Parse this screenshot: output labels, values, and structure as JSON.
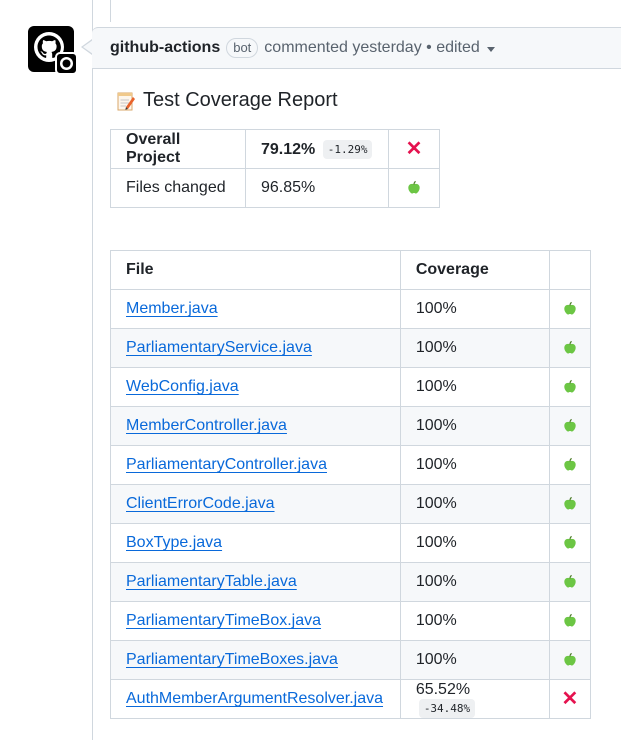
{
  "comment": {
    "author": "github-actions",
    "badge": "bot",
    "meta": "commented yesterday • edited"
  },
  "report": {
    "title": "Test Coverage Report",
    "title_icon": "memo-icon"
  },
  "summary": [
    {
      "label": "Overall Project",
      "value": "79.12%",
      "delta": "-1.29%",
      "status": "fail"
    },
    {
      "label": "Files changed",
      "value": "96.85%",
      "delta": "",
      "status": "pass"
    }
  ],
  "files_table": {
    "headers": [
      "File",
      "Coverage",
      ""
    ],
    "rows": [
      {
        "file": "Member.java",
        "coverage": "100%",
        "delta": "",
        "status": "pass"
      },
      {
        "file": "ParliamentaryService.java",
        "coverage": "100%",
        "delta": "",
        "status": "pass"
      },
      {
        "file": "WebConfig.java",
        "coverage": "100%",
        "delta": "",
        "status": "pass"
      },
      {
        "file": "MemberController.java",
        "coverage": "100%",
        "delta": "",
        "status": "pass"
      },
      {
        "file": "ParliamentaryController.java",
        "coverage": "100%",
        "delta": "",
        "status": "pass"
      },
      {
        "file": "ClientErrorCode.java",
        "coverage": "100%",
        "delta": "",
        "status": "pass"
      },
      {
        "file": "BoxType.java",
        "coverage": "100%",
        "delta": "",
        "status": "pass"
      },
      {
        "file": "ParliamentaryTable.java",
        "coverage": "100%",
        "delta": "",
        "status": "pass"
      },
      {
        "file": "ParliamentaryTimeBox.java",
        "coverage": "100%",
        "delta": "",
        "status": "pass"
      },
      {
        "file": "ParliamentaryTimeBoxes.java",
        "coverage": "100%",
        "delta": "",
        "status": "pass"
      },
      {
        "file": "AuthMemberArgumentResolver.java",
        "coverage": "65.52%",
        "delta": "-34.48%",
        "status": "fail"
      }
    ]
  },
  "colors": {
    "link": "#0969da",
    "fail": "#e5124f",
    "pass": "#6cc644"
  }
}
